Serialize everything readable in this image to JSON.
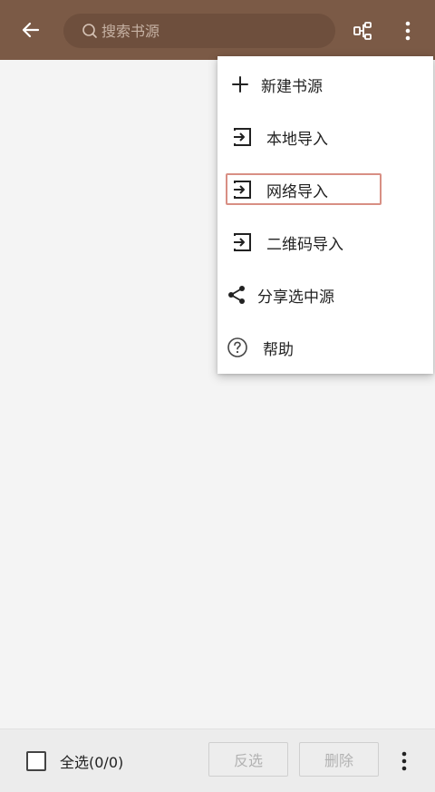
{
  "colors": {
    "accent": "#7b5a46",
    "highlight": "#d88f84"
  },
  "appbar": {
    "back_icon": "arrow-left-icon",
    "search": {
      "placeholder": "搜索书源",
      "value": ""
    },
    "group_icon": "group-icon",
    "more_icon": "more-vert-icon"
  },
  "menu": {
    "items": [
      {
        "label": "新建书源",
        "icon": "plus-icon"
      },
      {
        "label": "本地导入",
        "icon": "import-icon"
      },
      {
        "label": "网络导入",
        "icon": "import-icon"
      },
      {
        "label": "二维码导入",
        "icon": "import-icon"
      },
      {
        "label": "分享选中源",
        "icon": "share-icon"
      },
      {
        "label": "帮助",
        "icon": "help-icon"
      }
    ]
  },
  "bottombar": {
    "select_all": "全选(0/0)",
    "invert": "反选",
    "delete": "删除",
    "more_icon": "more-vert-icon"
  }
}
